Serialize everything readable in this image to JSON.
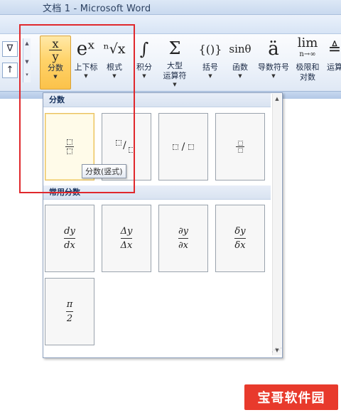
{
  "window": {
    "title": "文档 1 - Microsoft Word"
  },
  "ribbon": {
    "left_symbols": [
      {
        "glyph": "∇",
        "icon": "nabla-symbol-icon"
      },
      {
        "glyph": "↑",
        "icon": "up-arrow-symbol-icon"
      }
    ],
    "buttons": [
      {
        "id": "fraction",
        "label": "分数",
        "glyph_top": "x",
        "glyph_bottom": "y",
        "icon": "fraction-icon",
        "active": true
      },
      {
        "id": "script",
        "label": "上下标",
        "glyph": "eˣ",
        "icon": "script-icon"
      },
      {
        "id": "radical",
        "label": "根式",
        "glyph": "ⁿ√x",
        "icon": "radical-icon"
      },
      {
        "id": "integral",
        "label": "积分",
        "glyph": "∫",
        "icon": "integral-icon"
      },
      {
        "id": "largeop",
        "label": "大型",
        "label2": "运算符",
        "glyph": "Σ",
        "icon": "summation-icon"
      },
      {
        "id": "bracket",
        "label": "括号",
        "glyph": "{()}",
        "icon": "bracket-icon"
      },
      {
        "id": "function",
        "label": "函数",
        "glyph": "sinθ",
        "icon": "function-icon"
      },
      {
        "id": "accent",
        "label": "导数符号",
        "glyph": "ä",
        "icon": "accent-icon"
      },
      {
        "id": "limit",
        "label": "极限和",
        "label2": "对数",
        "glyph": "lim",
        "glyph_sub": "n→∞",
        "icon": "limit-icon"
      },
      {
        "id": "operator",
        "label": "运算",
        "glyph": "≜",
        "icon": "operator-icon"
      }
    ]
  },
  "gallery": {
    "section_fraction": "分数",
    "fraction_items": [
      {
        "name": "stacked-fraction",
        "kind": "stacked"
      },
      {
        "name": "skewed-fraction",
        "kind": "skewed",
        "text": "/"
      },
      {
        "name": "linear-fraction",
        "kind": "linear",
        "text": "/"
      },
      {
        "name": "small-fraction",
        "kind": "small"
      }
    ],
    "tooltip": "分数(竖式)",
    "section_common": "常用分数",
    "common_items": [
      {
        "num": "dy",
        "den": "dx"
      },
      {
        "num": "Δy",
        "den": "Δx"
      },
      {
        "num": "∂y",
        "den": "∂x"
      },
      {
        "num": "δy",
        "den": "δx"
      },
      {
        "num": "π",
        "den": "2"
      }
    ]
  },
  "watermark": {
    "text": "宝哥软件园"
  }
}
